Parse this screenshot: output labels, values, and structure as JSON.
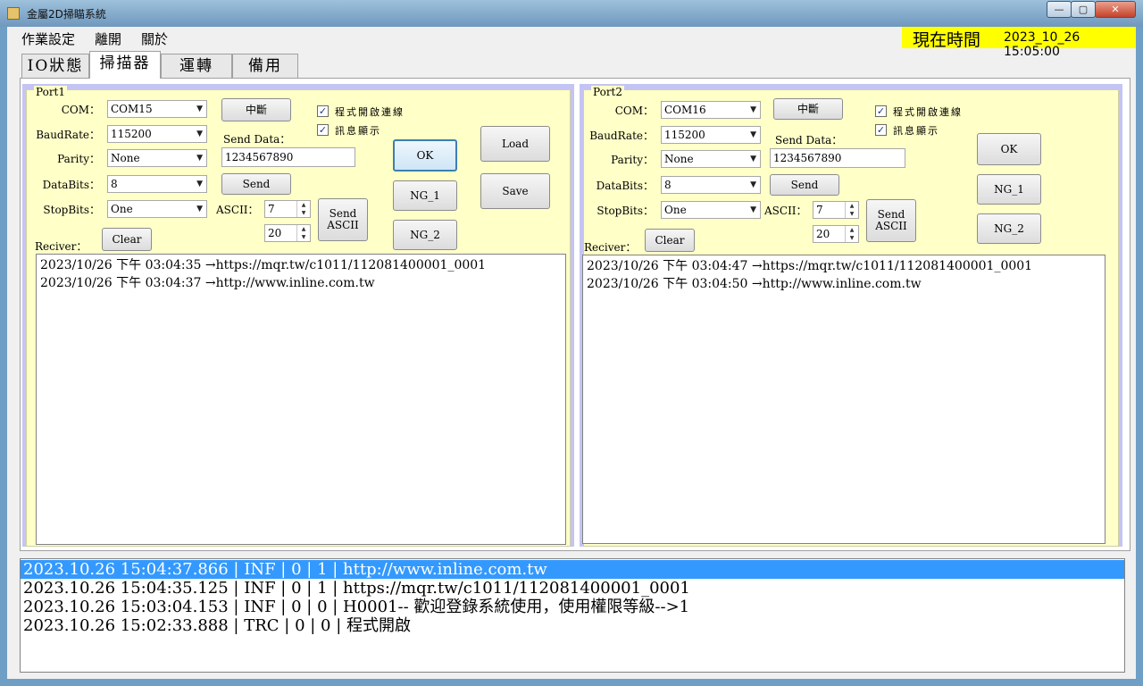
{
  "window": {
    "title": "金屬2D掃瞄系統",
    "buttons": {
      "minimize": "—",
      "maximize": "▢",
      "close": "✕"
    }
  },
  "menu": [
    "作業設定",
    "離開",
    "關於"
  ],
  "clock": {
    "label": "現在時間",
    "value": "2023_10_26 15:05:00"
  },
  "tabs": [
    "IO狀態",
    "掃描器",
    "運轉",
    "備用"
  ],
  "active_tab": "掃描器",
  "port1": {
    "title": "Port1",
    "com_label": "COM：",
    "com": "COM15",
    "baud_label": "BaudRate：",
    "baud": "115200",
    "parity_label": "Parity：",
    "parity": "None",
    "databits_label": "DataBits：",
    "databits": "8",
    "stopbits_label": "StopBits：",
    "stopbits": "One",
    "disconnect": "中斷",
    "send_data_label": "Send Data：",
    "send_data": "1234567890",
    "send": "Send",
    "ascii_label": "ASCII：",
    "ascii1": "7",
    "ascii2": "20",
    "send_ascii": "Send\nASCII",
    "auto_connect": "程式開啟連線",
    "show_msg": "訊息顯示",
    "receiver_label": "Reciver：",
    "clear": "Clear",
    "ok": "OK",
    "ng1": "NG_1",
    "ng2": "NG_2",
    "load": "Load",
    "save": "Save",
    "lines": [
      "2023/10/26 下午 03:04:35  →https://mqr.tw/c1011/112081400001_0001",
      "2023/10/26 下午 03:04:37  →http://www.inline.com.tw"
    ]
  },
  "port2": {
    "title": "Port2",
    "com_label": "COM：",
    "com": "COM16",
    "baud_label": "BaudRate：",
    "baud": "115200",
    "parity_label": "Parity：",
    "parity": "None",
    "databits_label": "DataBits：",
    "databits": "8",
    "stopbits_label": "StopBits：",
    "stopbits": "One",
    "disconnect": "中斷",
    "send_data_label": "Send Data：",
    "send_data": "1234567890",
    "send": "Send",
    "ascii_label": "ASCII：",
    "ascii1": "7",
    "ascii2": "20",
    "send_ascii": "Send\nASCII",
    "auto_connect": "程式開啟連線",
    "show_msg": "訊息顯示",
    "receiver_label": "Reciver：",
    "clear": "Clear",
    "ok": "OK",
    "ng1": "NG_1",
    "ng2": "NG_2",
    "lines": [
      "2023/10/26 下午 03:04:47  →https://mqr.tw/c1011/112081400001_0001",
      "2023/10/26 下午 03:04:50  →http://www.inline.com.tw"
    ]
  },
  "log": [
    {
      "time": "2023.10.26 15:04:37.866",
      "level": "INF",
      "a": "0",
      "b": "1",
      "msg": "http://www.inline.com.tw",
      "selected": true
    },
    {
      "time": "2023.10.26 15:04:35.125",
      "level": "INF",
      "a": "0",
      "b": "1",
      "msg": "https://mqr.tw/c1011/112081400001_0001",
      "selected": false
    },
    {
      "time": "2023.10.26 15:03:04.153",
      "level": "INF",
      "a": "0",
      "b": "0",
      "msg": "H0001-- 歡迎登錄系統使用，使用權限等級-->1",
      "selected": false
    },
    {
      "time": "2023.10.26 15:02:33.888",
      "level": "TRC",
      "a": "0",
      "b": "0",
      "msg": "程式開啟",
      "selected": false
    }
  ],
  "colors": {
    "clock_bg": "#ffff00",
    "panel_bg": "#ffffc8",
    "port_frame": "#c4c4f4",
    "selection": "#3399ff"
  }
}
